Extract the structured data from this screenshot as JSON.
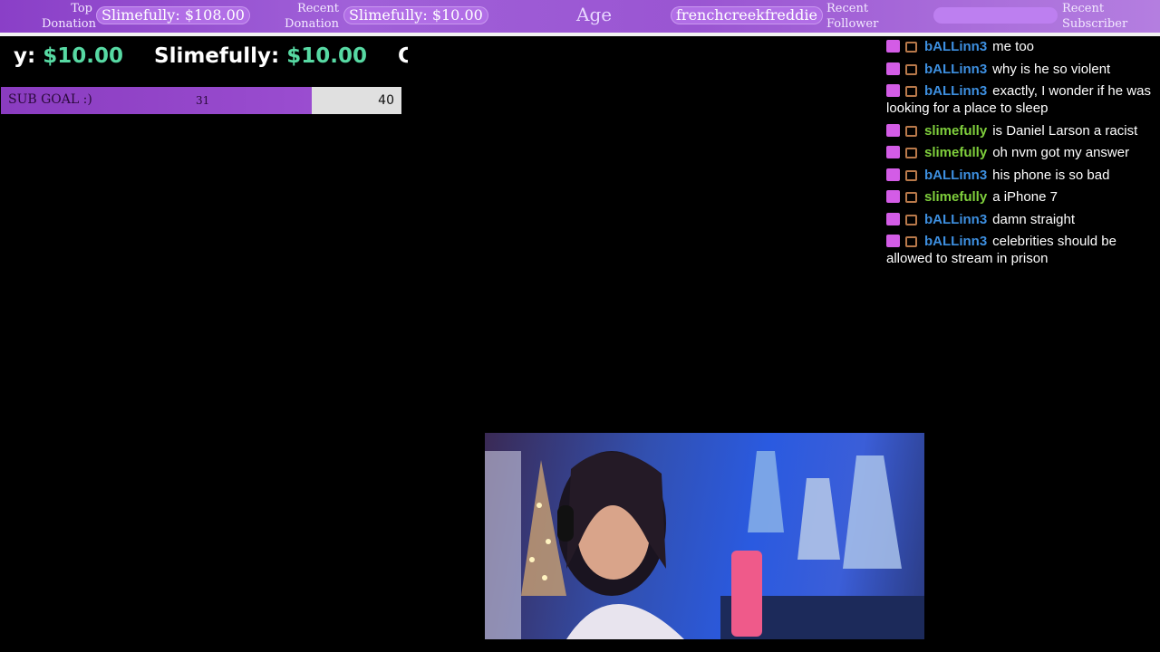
{
  "topbar": {
    "top_donation_label_1": "Top",
    "top_donation_label_2": "Donation",
    "top_donation_value": "Slimefully: $108.00",
    "recent_donation_label_1": "Recent",
    "recent_donation_label_2": "Donation",
    "recent_donation_value": "Slimefully: $10.00",
    "age_label": "Age",
    "recent_follower_value": "frenchcreekfreddie",
    "recent_follower_label_1": "Recent",
    "recent_follower_label_2": "Follower",
    "recent_subscriber_label_1": "Recent",
    "recent_subscriber_label_2": "Subscriber"
  },
  "ticker": {
    "items": [
      {
        "name": "y:",
        "amount": "$10.00"
      },
      {
        "name": "Slimefully:",
        "amount": "$10.00"
      },
      {
        "name": "Cl",
        "amount": ""
      }
    ]
  },
  "sub_goal": {
    "label": "SUB GOAL :)",
    "current": "31",
    "target": "40",
    "progress_fraction": 0.775
  },
  "chat": {
    "messages": [
      {
        "user": "bALLinn3",
        "color": "#3d8fe0",
        "text": "me too"
      },
      {
        "user": "bALLinn3",
        "color": "#3d8fe0",
        "text": "why is he so violent"
      },
      {
        "user": "bALLinn3",
        "color": "#3d8fe0",
        "text": "exactly, I wonder if he was looking for a place to sleep"
      },
      {
        "user": "slimefully",
        "color": "#7fcf3c",
        "text": "is Daniel Larson a racist"
      },
      {
        "user": "slimefully",
        "color": "#7fcf3c",
        "text": "oh nvm got my answer"
      },
      {
        "user": "bALLinn3",
        "color": "#3d8fe0",
        "text": "his phone is so bad"
      },
      {
        "user": "slimefully",
        "color": "#7fcf3c",
        "text": "a iPhone 7"
      },
      {
        "user": "bALLinn3",
        "color": "#3d8fe0",
        "text": "damn straight"
      },
      {
        "user": "bALLinn3",
        "color": "#3d8fe0",
        "text": "celebrities should be allowed to stream in prison"
      }
    ]
  },
  "colors": {
    "accent_purple": "#9a4dd0",
    "amount_green": "#57d9a3",
    "user_blue": "#3d8fe0",
    "user_green": "#7fcf3c"
  }
}
